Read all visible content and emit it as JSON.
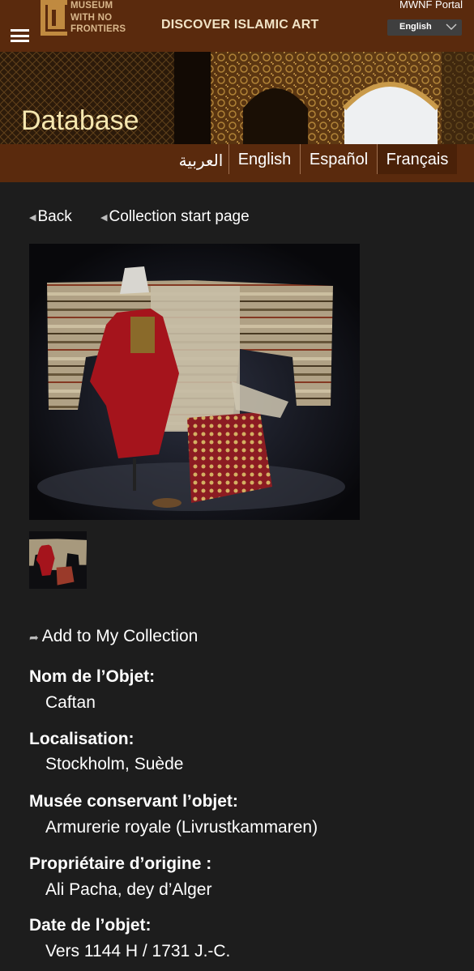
{
  "header": {
    "logo_lines": [
      "MUSEUM",
      "WITH NO",
      "FRONTIERS"
    ],
    "site_title": "DISCOVER ISLAMIC ART",
    "portal_link": "MWNF Portal",
    "language_select": "English",
    "icons": {
      "menu": "hamburger-icon",
      "select": "chevron-down-icon"
    }
  },
  "banner": {
    "page_title": "Database"
  },
  "languages": [
    "العربية",
    "English",
    "Español",
    "Français"
  ],
  "active_language": "Français",
  "nav": {
    "back": "Back",
    "collection_start": "Collection start page"
  },
  "add_collection": "Add to My Collection",
  "fields": [
    {
      "label": "Nom de l’Objet:",
      "value": "Caftan"
    },
    {
      "label": "Localisation:",
      "value": "Stockholm, Suède"
    },
    {
      "label": "Musée conservant l’objet:",
      "value": "Armurerie royale (Livrustkammaren)"
    },
    {
      "label": "Propriétaire d’origine :",
      "value": "Ali Pacha, dey d’Alger"
    },
    {
      "label": "Date de l’objet:",
      "value": "Vers 1144 H / 1731 J.-C."
    }
  ],
  "colors": {
    "header_brown": "#5a2a0d",
    "background": "#1d1d1d",
    "title_cream": "#f6e7b0"
  }
}
